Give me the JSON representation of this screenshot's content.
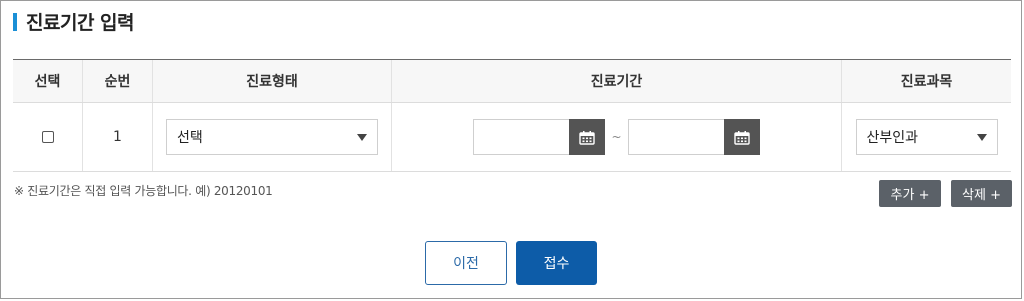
{
  "section": {
    "title": "진료기간 입력"
  },
  "table": {
    "headers": [
      "선택",
      "순번",
      "진료형태",
      "진료기간",
      "진료과목"
    ],
    "row": {
      "checked": false,
      "index": "1",
      "care_type": "선택",
      "date_from": "",
      "date_to": "",
      "separator": "~",
      "department": "산부인과"
    }
  },
  "note": "※ 진료기간은 직접 입력 가능합니다. 예) 20120101",
  "buttons": {
    "add": "추가 +",
    "delete": "삭제 +",
    "prev": "이전",
    "submit": "접수"
  },
  "colors": {
    "accent": "#1a8fd6",
    "primary": "#0d5ca8",
    "small_button": "#5b6168",
    "calendar_button": "#545454"
  },
  "icons": {
    "calendar": "calendar-icon",
    "dropdown": "chevron-down-icon"
  }
}
